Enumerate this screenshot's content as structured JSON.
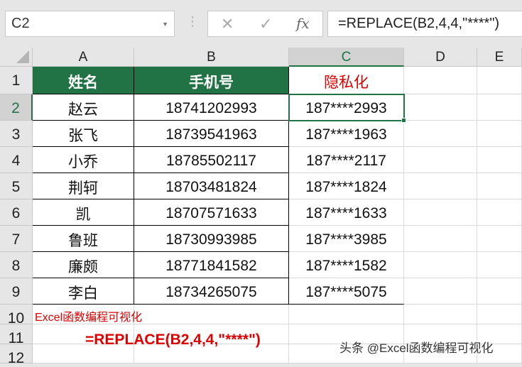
{
  "name_box": "C2",
  "formula": "=REPLACE(B2,4,4,\"****\")",
  "icons": {
    "cancel": "✕",
    "enter": "✓",
    "fx": "fx"
  },
  "columns": [
    "A",
    "B",
    "C",
    "D",
    "E"
  ],
  "rows": [
    "1",
    "2",
    "3",
    "4",
    "5",
    "6",
    "7",
    "8",
    "9",
    "10",
    "11",
    "12"
  ],
  "headers": [
    "姓名",
    "手机号",
    "隐私化"
  ],
  "data": [
    [
      "赵云",
      "18741202993",
      "187****2993"
    ],
    [
      "张飞",
      "18739541963",
      "187****1963"
    ],
    [
      "小乔",
      "18785502117",
      "187****2117"
    ],
    [
      "荆轲",
      "18703481824",
      "187****1824"
    ],
    [
      "凯",
      "18707571633",
      "187****1633"
    ],
    [
      "鲁班",
      "18730993985",
      "187****3985"
    ],
    [
      "廉颇",
      "18771841582",
      "187****1582"
    ],
    [
      "李白",
      "18734265075",
      "187****5075"
    ]
  ],
  "note": "Excel函数编程可视化",
  "formula_display": "=REPLACE(B2,4,4,\"****\")",
  "watermark": "头条 @Excel函数编程可视化",
  "colors": {
    "header_green": "#217346",
    "red": "#e00000"
  }
}
